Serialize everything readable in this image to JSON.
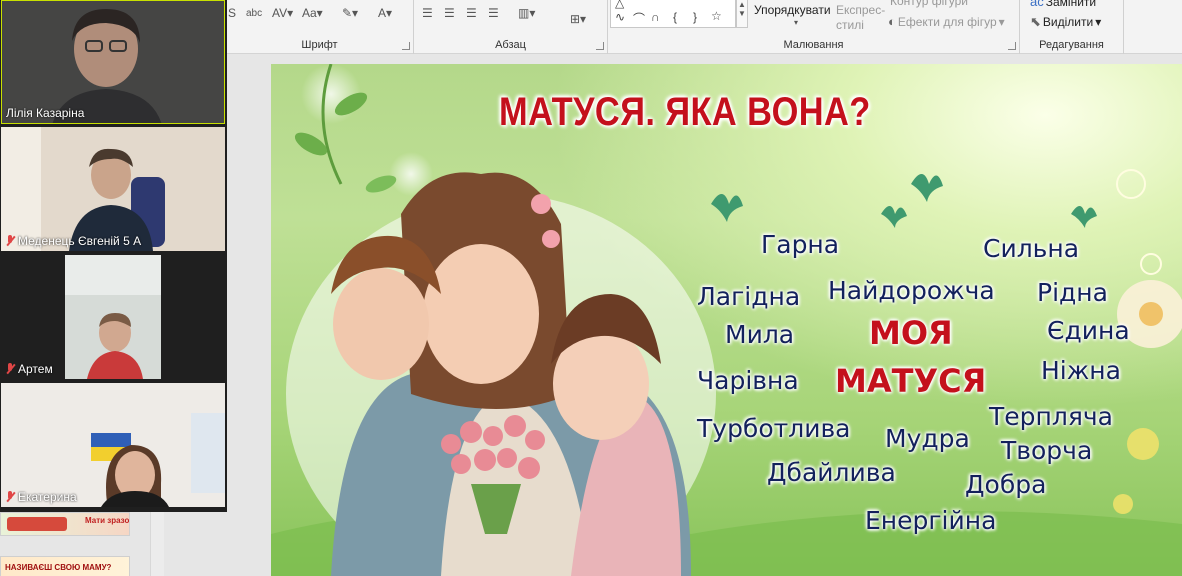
{
  "ribbon": {
    "font_group": "Шрифт",
    "paragraph_group": "Абзац",
    "drawing_group": "Малювання",
    "editing_group": "Редагування",
    "arrange_label": "Упорядкувати",
    "quick_styles_label": "Експрес-\nстилі",
    "shape_outline_label": "Контур фігури",
    "shape_effects_label": "Ефекти для фігур",
    "replace_label": "Замінити",
    "select_label": "Виділити"
  },
  "participants": [
    {
      "name": "Лілія Казаріна",
      "muted": false
    },
    {
      "name": "Меденець Євгеній 5 А",
      "muted": true
    },
    {
      "name": "Артем",
      "muted": true
    },
    {
      "name": "Екатерина",
      "muted": true
    }
  ],
  "thumbnails": [
    {
      "title": "Мати зразок"
    },
    {
      "title": "НАЗИВАЄШ СВОЮ МАМУ?"
    }
  ],
  "slide": {
    "title": "МАТУСЯ. ЯКА ВОНА?",
    "center_words": [
      "МОЯ",
      "МАТУСЯ"
    ],
    "words": [
      "Гарна",
      "Сильна",
      "Лагідна",
      "Найдорожча",
      "Рідна",
      "Мила",
      "Єдина",
      "Чарівна",
      "Ніжна",
      "Турботлива",
      "Терпляча",
      "Мудра",
      "Творча",
      "Дбайлива",
      "Добра",
      "Енергійна"
    ]
  },
  "colors": {
    "title_red": "#c4101c",
    "word_navy": "#13215c",
    "mute_red": "#e04646"
  }
}
